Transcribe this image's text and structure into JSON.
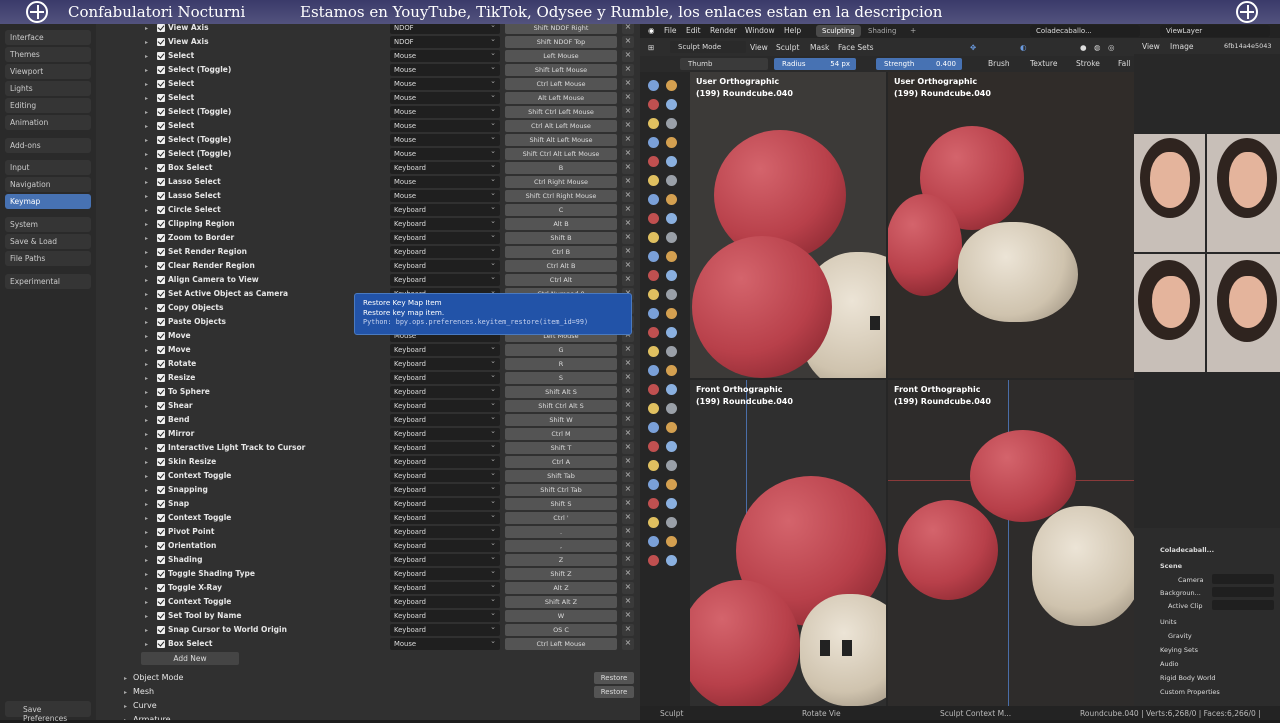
{
  "banner": {
    "title": "Confabulatori Nocturni",
    "message": "Estamos en YouyTube, TikTok, Odysee y Rumble, los enlaces estan en la descripcion"
  },
  "sidebar": {
    "items": [
      "Interface",
      "Themes",
      "Viewport",
      "Lights",
      "Editing",
      "Animation",
      "Add-ons",
      "Input",
      "Navigation",
      "Keymap",
      "System",
      "Save & Load",
      "File Paths",
      "Experimental"
    ],
    "active": "Keymap",
    "save_label": "Save Preferences"
  },
  "keymap": {
    "rows": [
      {
        "name": "View Axis",
        "device": "NDOF",
        "key": "Shift NDOF Right"
      },
      {
        "name": "View Axis",
        "device": "NDOF",
        "key": "Shift NDOF Top"
      },
      {
        "name": "Select",
        "device": "Mouse",
        "key": "Left Mouse"
      },
      {
        "name": "Select (Toggle)",
        "device": "Mouse",
        "key": "Shift Left Mouse"
      },
      {
        "name": "Select",
        "device": "Mouse",
        "key": "Ctrl Left Mouse"
      },
      {
        "name": "Select",
        "device": "Mouse",
        "key": "Alt Left Mouse"
      },
      {
        "name": "Select (Toggle)",
        "device": "Mouse",
        "key": "Shift Ctrl Left Mouse"
      },
      {
        "name": "Select",
        "device": "Mouse",
        "key": "Ctrl Alt Left Mouse"
      },
      {
        "name": "Select (Toggle)",
        "device": "Mouse",
        "key": "Shift Alt Left Mouse"
      },
      {
        "name": "Select (Toggle)",
        "device": "Mouse",
        "key": "Shift Ctrl Alt Left Mouse"
      },
      {
        "name": "Box Select",
        "device": "Keyboard",
        "key": "B"
      },
      {
        "name": "Lasso Select",
        "device": "Mouse",
        "key": "Ctrl Right Mouse"
      },
      {
        "name": "Lasso Select",
        "device": "Mouse",
        "key": "Shift Ctrl Right Mouse"
      },
      {
        "name": "Circle Select",
        "device": "Keyboard",
        "key": "C"
      },
      {
        "name": "Clipping Region",
        "device": "Keyboard",
        "key": "Alt B"
      },
      {
        "name": "Zoom to Border",
        "device": "Keyboard",
        "key": "Shift B"
      },
      {
        "name": "Set Render Region",
        "device": "Keyboard",
        "key": "Ctrl B"
      },
      {
        "name": "Clear Render Region",
        "device": "Keyboard",
        "key": "Ctrl Alt B"
      },
      {
        "name": "Align Camera to View",
        "device": "Keyboard",
        "key": "Ctrl Alt"
      },
      {
        "name": "Set Active Object as Camera",
        "device": "Keyboard",
        "key": "Ctrl Numpad 0"
      },
      {
        "name": "Copy Objects",
        "device": "Keyboard",
        "key": "Ctrl C"
      },
      {
        "name": "Paste Objects",
        "device": "Keyboard",
        "key": "Ctrl V"
      },
      {
        "name": "Move",
        "device": "Mouse",
        "key": "Left Mouse"
      },
      {
        "name": "Move",
        "device": "Keyboard",
        "key": "G"
      },
      {
        "name": "Rotate",
        "device": "Keyboard",
        "key": "R"
      },
      {
        "name": "Resize",
        "device": "Keyboard",
        "key": "S"
      },
      {
        "name": "To Sphere",
        "device": "Keyboard",
        "key": "Shift Alt S"
      },
      {
        "name": "Shear",
        "device": "Keyboard",
        "key": "Shift Ctrl Alt S"
      },
      {
        "name": "Bend",
        "device": "Keyboard",
        "key": "Shift W"
      },
      {
        "name": "Mirror",
        "device": "Keyboard",
        "key": "Ctrl M"
      },
      {
        "name": "Interactive Light Track to Cursor",
        "device": "Keyboard",
        "key": "Shift T"
      },
      {
        "name": "Skin Resize",
        "device": "Keyboard",
        "key": "Ctrl A"
      },
      {
        "name": "Context Toggle",
        "device": "Keyboard",
        "key": "Shift Tab"
      },
      {
        "name": "Snapping",
        "device": "Keyboard",
        "key": "Shift Ctrl Tab"
      },
      {
        "name": "Snap",
        "device": "Keyboard",
        "key": "Shift S"
      },
      {
        "name": "Context Toggle",
        "device": "Keyboard",
        "key": "Ctrl '"
      },
      {
        "name": "Pivot Point",
        "device": "Keyboard",
        "key": "."
      },
      {
        "name": "Orientation",
        "device": "Keyboard",
        "key": ","
      },
      {
        "name": "Shading",
        "device": "Keyboard",
        "key": "Z"
      },
      {
        "name": "Toggle Shading Type",
        "device": "Keyboard",
        "key": "Shift Z"
      },
      {
        "name": "Toggle X-Ray",
        "device": "Keyboard",
        "key": "Alt Z"
      },
      {
        "name": "Context Toggle",
        "device": "Keyboard",
        "key": "Shift Alt Z"
      },
      {
        "name": "Set Tool by Name",
        "device": "Keyboard",
        "key": "W"
      },
      {
        "name": "Snap Cursor to World Origin",
        "device": "Keyboard",
        "key": "OS C"
      },
      {
        "name": "Box Select",
        "device": "Mouse",
        "key": "Ctrl Left Mouse"
      }
    ],
    "add_new": "Add New",
    "categories": [
      "Object Mode",
      "Mesh",
      "Curve",
      "Armature"
    ],
    "restore_label": "Restore"
  },
  "tooltip": {
    "title": "Restore Key Map Item",
    "desc": "Restore key map item.",
    "python": "Python: bpy.ops.preferences.keyitem_restore(item_id=99)"
  },
  "blender": {
    "menu": [
      "File",
      "Edit",
      "Render",
      "Window",
      "Help"
    ],
    "workspaces": [
      "Sculpting",
      "Shading"
    ],
    "scene_name": "Coladecaballo...",
    "view_layer": "ViewLayer",
    "mode": "Sculpt Mode",
    "header_menus": [
      "View",
      "Sculpt",
      "Mask",
      "Face Sets"
    ],
    "brush_name": "Thumb",
    "radius_label": "Radius",
    "radius_value": "54 px",
    "strength_label": "Strength",
    "strength_value": "0.400",
    "tool_menus": [
      "Brush",
      "Texture",
      "Stroke",
      "Fall"
    ],
    "viewports": [
      {
        "view": "User Orthographic",
        "object": "(199) Roundcube.040"
      },
      {
        "view": "User Orthographic",
        "object": "(199) Roundcube.040"
      },
      {
        "view": "Front Orthographic",
        "object": "(199) Roundcube.040"
      },
      {
        "view": "Front Orthographic",
        "object": "(199) Roundcube.040"
      }
    ],
    "image_menus": [
      "View",
      "Image"
    ],
    "image_name": "6fb14a4e5043",
    "props": {
      "object": "Coladecaball...",
      "scene": "Scene",
      "camera_label": "Camera",
      "background_label": "Backgroun...",
      "active_clip_label": "Active Clip",
      "units": "Units",
      "gravity": "Gravity",
      "keying_sets": "Keying Sets",
      "audio": "Audio",
      "rigid_body": "Rigid Body World",
      "custom_props": "Custom Properties"
    },
    "status": {
      "left": "Sculpt",
      "mid": "Rotate Vie",
      "ctx": "Sculpt Context M...",
      "stats": "Roundcube.040 | Verts:6,268/0 | Faces:6,266/0 |"
    }
  }
}
